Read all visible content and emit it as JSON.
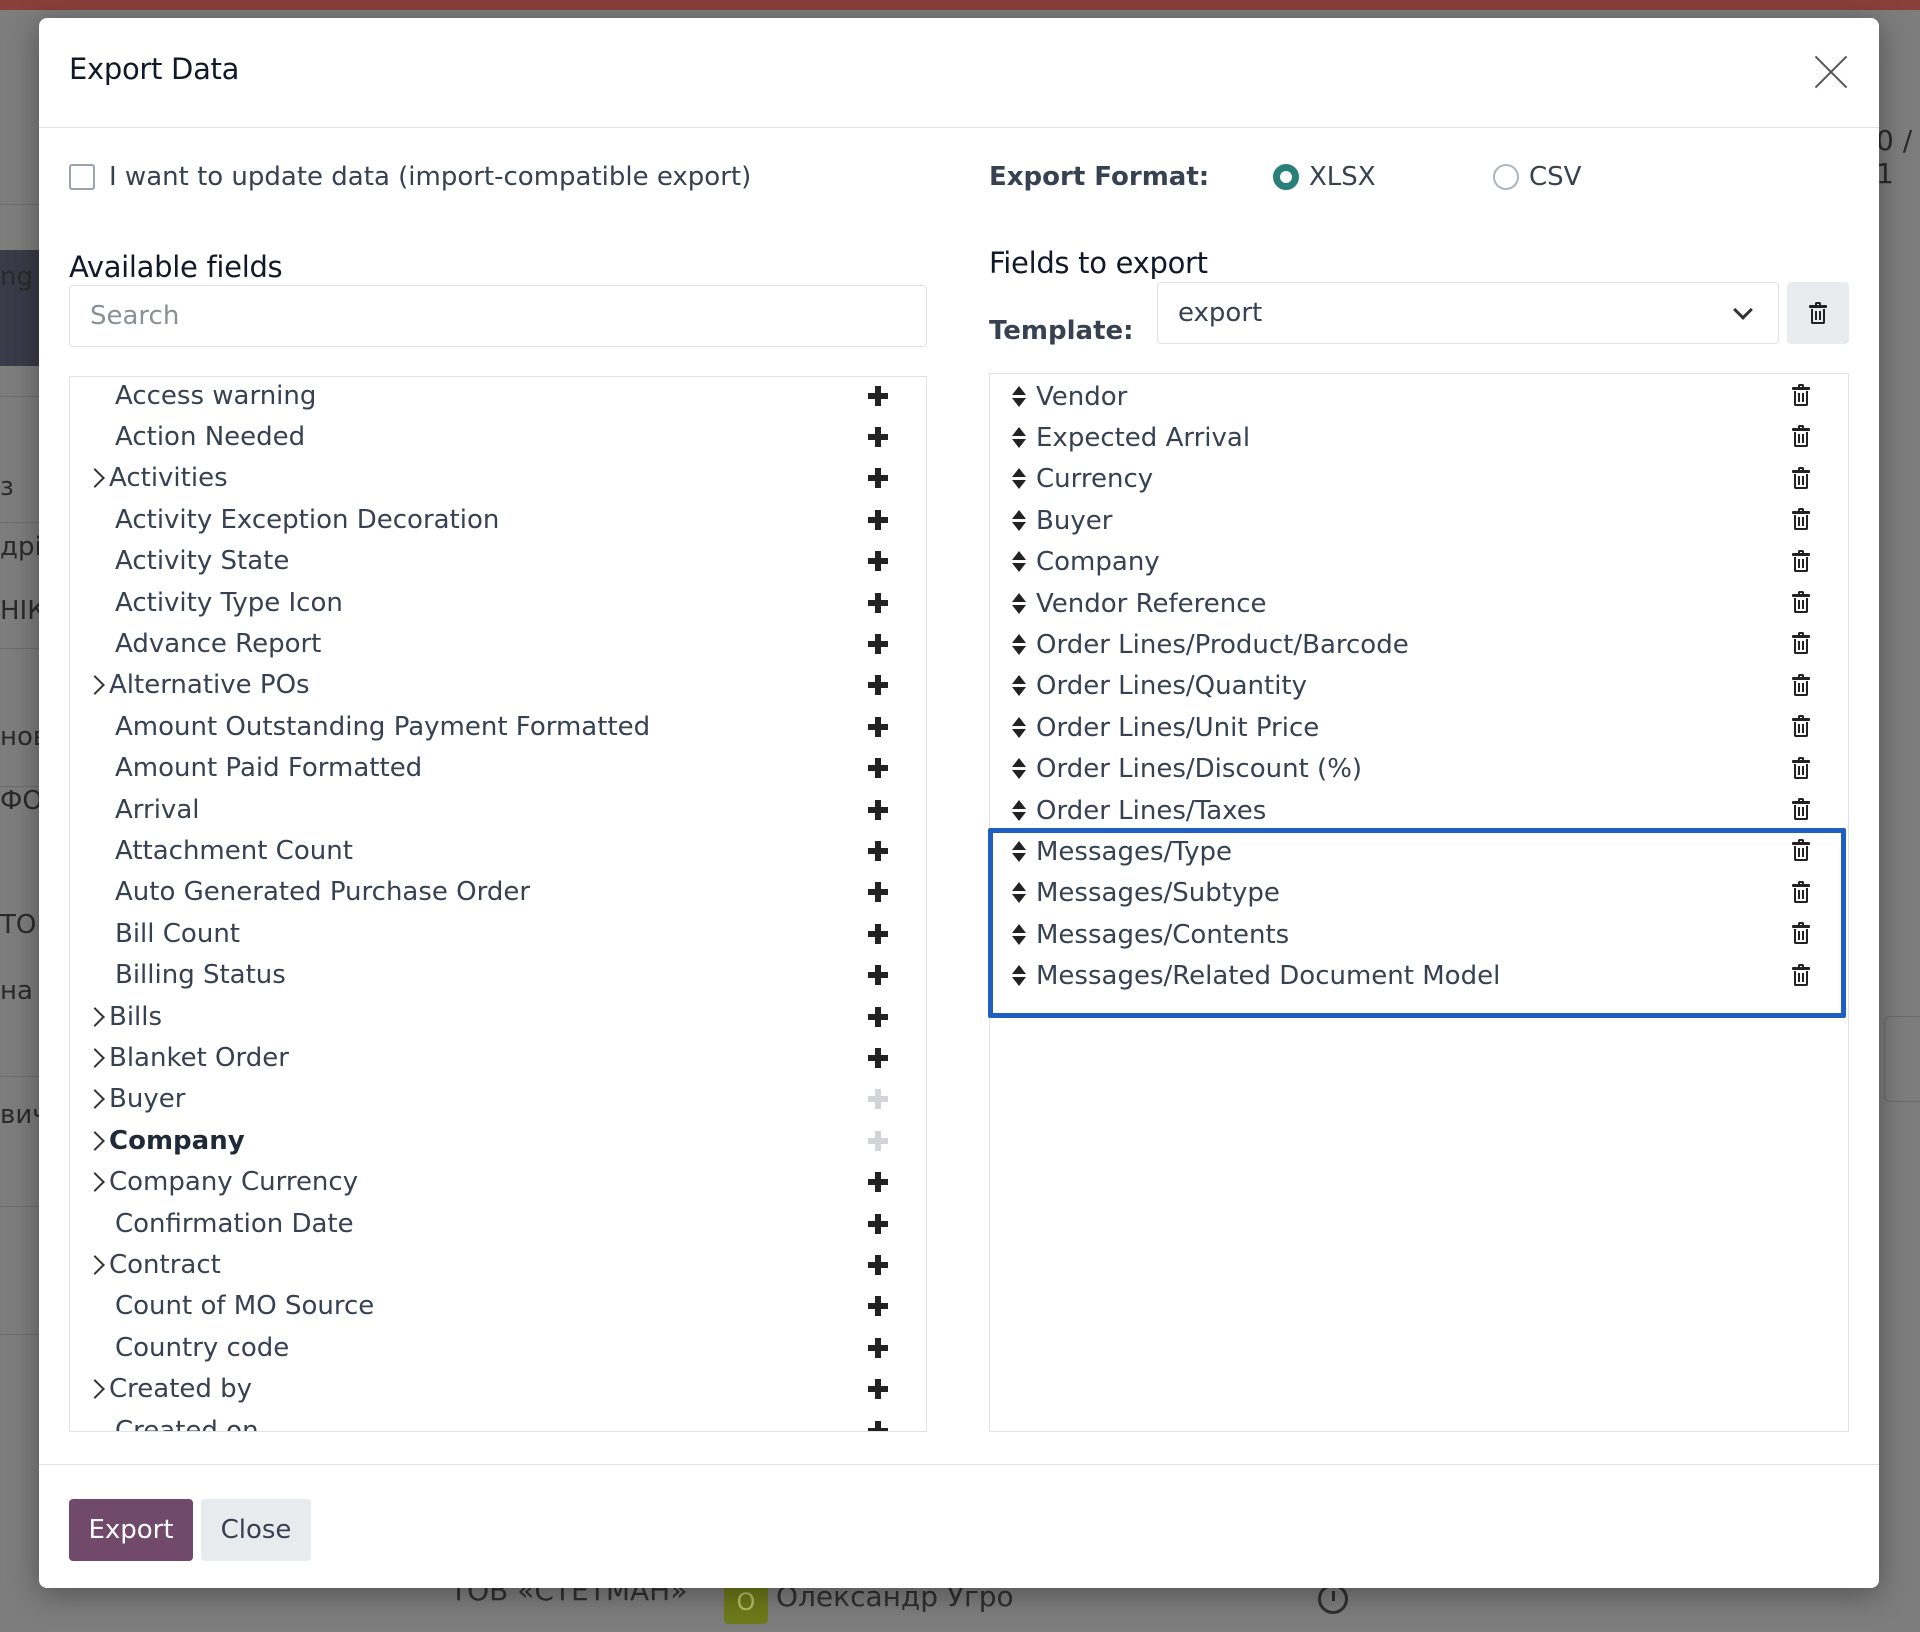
{
  "background": {
    "fragments": [
      "ng",
      "з",
      "дрі",
      "НІК",
      "нові",
      "ФОГ",
      "ТОВ",
      "на Ф",
      "вич"
    ],
    "right_fragment": "0 / 1",
    "bottom_row": {
      "company": "ТОВ «СТЕТМАН»",
      "avatar_letter": "О",
      "user": "Олександр Угро"
    }
  },
  "modal": {
    "title": "Export Data",
    "import_compatible_label": "I want to update data (import-compatible export)",
    "import_compatible_checked": false,
    "export_format_label": "Export Format:",
    "formats": [
      {
        "label": "XLSX",
        "selected": true
      },
      {
        "label": "CSV",
        "selected": false
      }
    ],
    "available_fields_title": "Available fields",
    "search_placeholder": "Search",
    "fields_to_export_title": "Fields to export",
    "template_label": "Template:",
    "template_value": "export",
    "available_fields": [
      {
        "label": "Access warning",
        "expandable": false,
        "bold": false,
        "addable": true
      },
      {
        "label": "Action Needed",
        "expandable": false,
        "bold": false,
        "addable": true
      },
      {
        "label": "Activities",
        "expandable": true,
        "bold": false,
        "addable": true
      },
      {
        "label": "Activity Exception Decoration",
        "expandable": false,
        "bold": false,
        "addable": true
      },
      {
        "label": "Activity State",
        "expandable": false,
        "bold": false,
        "addable": true
      },
      {
        "label": "Activity Type Icon",
        "expandable": false,
        "bold": false,
        "addable": true
      },
      {
        "label": "Advance Report",
        "expandable": false,
        "bold": false,
        "addable": true
      },
      {
        "label": "Alternative POs",
        "expandable": true,
        "bold": false,
        "addable": true
      },
      {
        "label": "Amount Outstanding Payment Formatted",
        "expandable": false,
        "bold": false,
        "addable": true
      },
      {
        "label": "Amount Paid Formatted",
        "expandable": false,
        "bold": false,
        "addable": true
      },
      {
        "label": "Arrival",
        "expandable": false,
        "bold": false,
        "addable": true
      },
      {
        "label": "Attachment Count",
        "expandable": false,
        "bold": false,
        "addable": true
      },
      {
        "label": "Auto Generated Purchase Order",
        "expandable": false,
        "bold": false,
        "addable": true
      },
      {
        "label": "Bill Count",
        "expandable": false,
        "bold": false,
        "addable": true
      },
      {
        "label": "Billing Status",
        "expandable": false,
        "bold": false,
        "addable": true
      },
      {
        "label": "Bills",
        "expandable": true,
        "bold": false,
        "addable": true
      },
      {
        "label": "Blanket Order",
        "expandable": true,
        "bold": false,
        "addable": true
      },
      {
        "label": "Buyer",
        "expandable": true,
        "bold": false,
        "addable": false
      },
      {
        "label": "Company",
        "expandable": true,
        "bold": true,
        "addable": false
      },
      {
        "label": "Company Currency",
        "expandable": true,
        "bold": false,
        "addable": true
      },
      {
        "label": "Confirmation Date",
        "expandable": false,
        "bold": false,
        "addable": true
      },
      {
        "label": "Contract",
        "expandable": true,
        "bold": false,
        "addable": true
      },
      {
        "label": "Count of MO Source",
        "expandable": false,
        "bold": false,
        "addable": true
      },
      {
        "label": "Country code",
        "expandable": false,
        "bold": false,
        "addable": true
      },
      {
        "label": "Created by",
        "expandable": true,
        "bold": false,
        "addable": true
      },
      {
        "label": "Created on",
        "expandable": false,
        "bold": false,
        "addable": true
      }
    ],
    "fields_to_export": [
      "Vendor",
      "Expected Arrival",
      "Currency",
      "Buyer",
      "Company",
      "Vendor Reference",
      "Order Lines/Product/Barcode",
      "Order Lines/Quantity",
      "Order Lines/Unit Price",
      "Order Lines/Discount (%)",
      "Order Lines/Taxes",
      "Messages/Type",
      "Messages/Subtype",
      "Messages/Contents",
      "Messages/Related Document Model"
    ],
    "highlighted_fields": [
      "Messages/Type",
      "Messages/Subtype",
      "Messages/Contents",
      "Messages/Related Document Model"
    ],
    "export_button": "Export",
    "close_button": "Close"
  },
  "colors": {
    "primary": "#71496a",
    "radio_accent": "#29807a",
    "highlight": "#1f5fbf",
    "topbar": "#8a3f3a"
  },
  "icons": [
    "close-icon",
    "checkbox-icon",
    "radio-icon",
    "chevron-down-icon",
    "trash-icon",
    "caret-right-icon",
    "plus-icon",
    "sort-handle-icon",
    "clock-icon"
  ]
}
